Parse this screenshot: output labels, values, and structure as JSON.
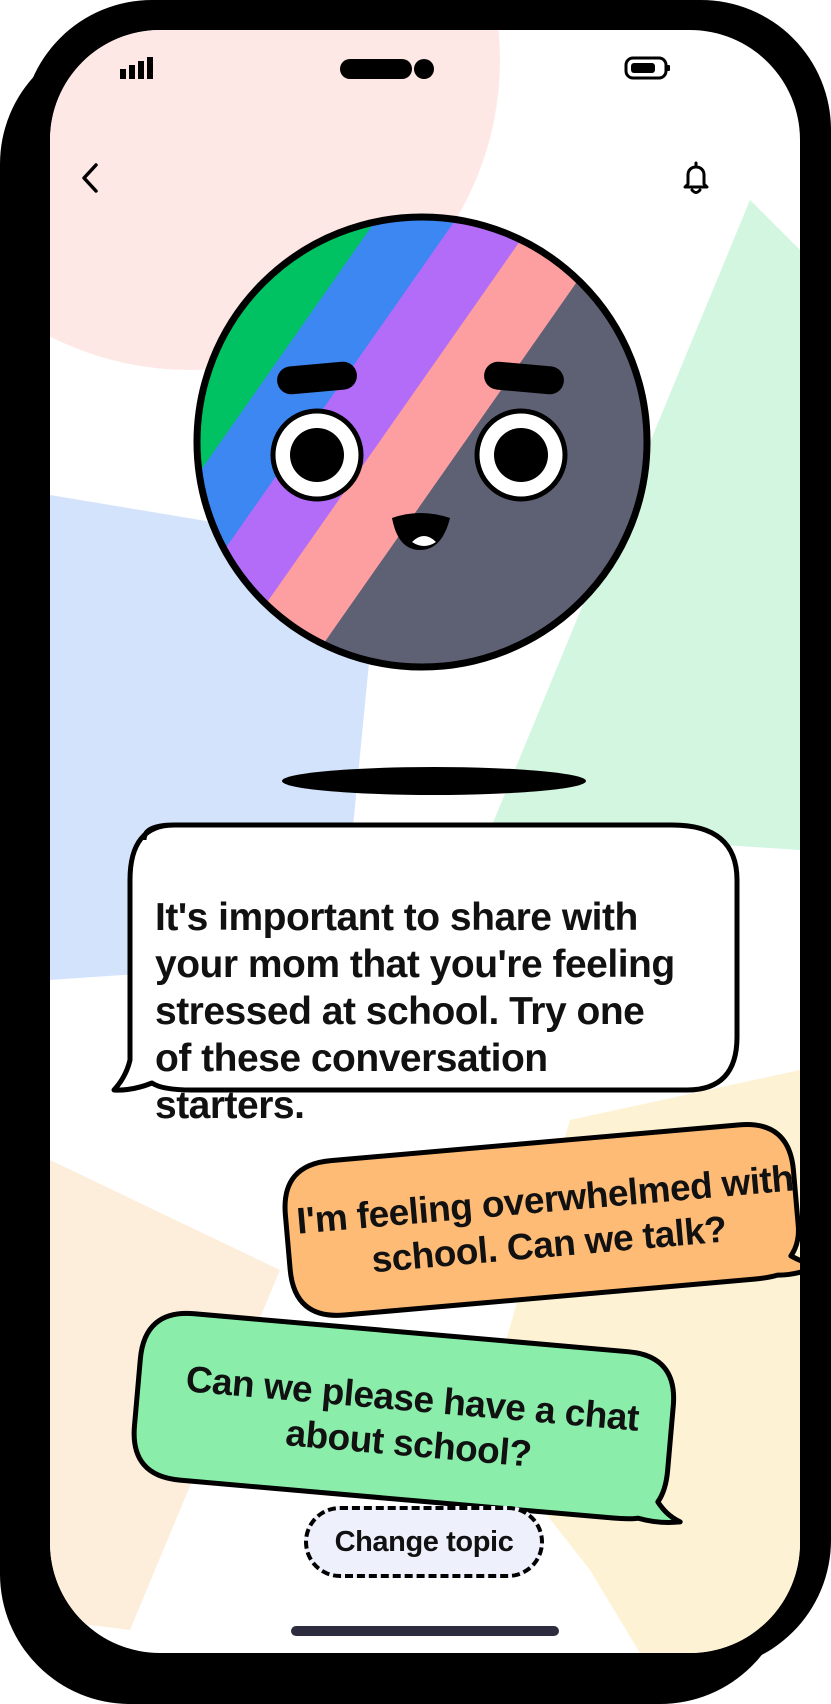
{
  "nav": {
    "back_icon": "chevron-left-icon",
    "notification_icon": "bell-icon"
  },
  "status_bar": {
    "signal_icon": "signal-bars-icon",
    "battery_icon": "battery-icon"
  },
  "assistant_message": "It's important to share with your mom that you're feeling stressed at school. Try one of these conversation starters.",
  "suggestions": [
    {
      "text": "I'm feeling overwhelmed with school. Can we talk?",
      "color": "#fdbb76"
    },
    {
      "text": "Can we please have a chat about school?",
      "color": "#8aeeaa"
    }
  ],
  "change_topic_label": "Change topic",
  "colors": {
    "frame": "#000000",
    "bg_pink": "#fde8e6",
    "bg_blue": "#d3e3fb",
    "bg_green": "#d2f6e0",
    "bg_peach": "#fdeedc",
    "bg_yellow": "#fef2d4",
    "button_fill": "#eef0fb"
  }
}
